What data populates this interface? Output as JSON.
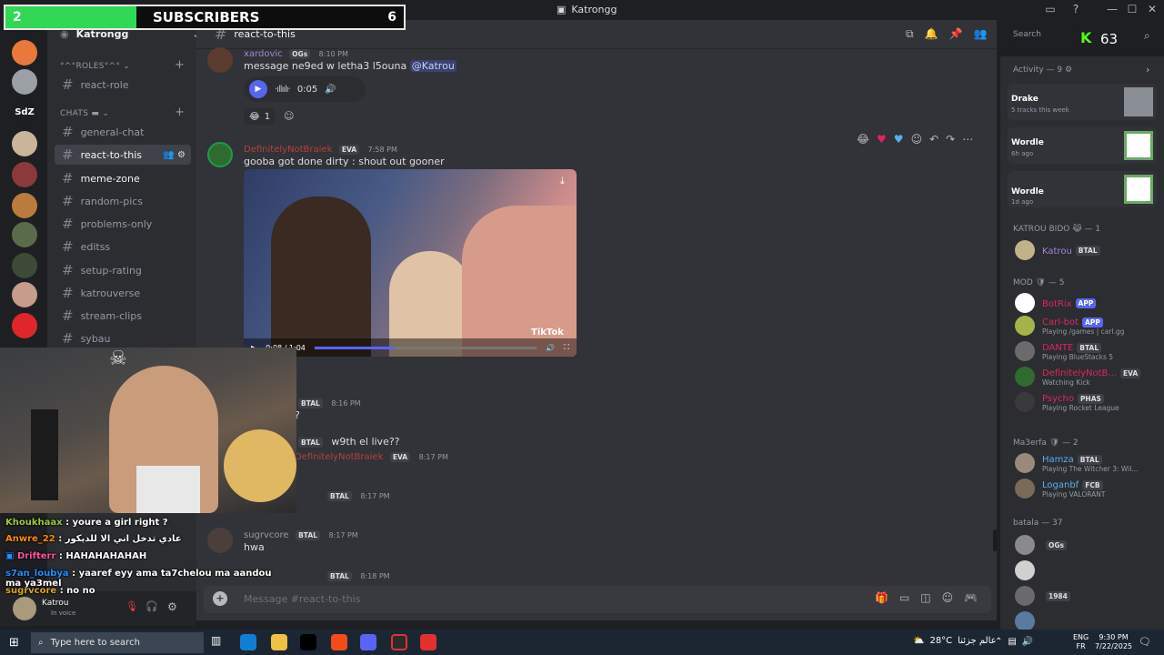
{
  "overlay": {
    "subscriber_count": "2",
    "subscriber_label": "SUBSCRIBERS",
    "subscriber_goal": "6"
  },
  "app": {
    "title": "Katrongg",
    "k_logo": "K",
    "k_count": "63"
  },
  "server": {
    "name": "Katrongg"
  },
  "categories": {
    "roles": "°^°ROLES°^°",
    "chats": "CHATS"
  },
  "channels": [
    {
      "name": "react-role"
    },
    {
      "name": "general-chat"
    },
    {
      "name": "react-to-this"
    },
    {
      "name": "meme-zone"
    },
    {
      "name": "random-pics"
    },
    {
      "name": "problems-only"
    },
    {
      "name": "editss"
    },
    {
      "name": "setup-rating"
    },
    {
      "name": "katrouverse"
    },
    {
      "name": "stream-clips"
    },
    {
      "name": "sybau"
    }
  ],
  "header": {
    "channel": "react-to-this",
    "search_placeholder": "Search"
  },
  "messages": {
    "m1": {
      "user": "xardovic",
      "tag": "OGs",
      "time": "8:10 PM",
      "text": "message ne9ed w letha3 l5ouna",
      "mention": "@Katrou",
      "audio_time": "0:05",
      "reaction_count": "1"
    },
    "m2": {
      "user": "DefinitelyNotBraiek",
      "tag": "EVA",
      "time": "7:58 PM",
      "text": "gooba got done dirty : shout out gooner",
      "video_time": "0:08 / 1:04",
      "watermark": "TikTok"
    },
    "m3": {
      "tag": "BTAL",
      "time": "8:16 PM",
      "text": "?"
    },
    "m4": {
      "tag": "BTAL",
      "text": "w9th el live??"
    },
    "m5": {
      "user": "DefinitelyNotBraiek",
      "tag": "EVA",
      "time": "8:17 PM"
    },
    "m6": {
      "tag": "BTAL",
      "time": "8:17 PM"
    },
    "m7": {
      "user": "sugrvcore",
      "tag": "BTAL",
      "time": "8:17 PM",
      "text": "hwa"
    },
    "m8": {
      "tag": "BTAL",
      "time": "8:18 PM"
    }
  },
  "composer": {
    "placeholder": "Message #react-to-this"
  },
  "activity": {
    "label": "Activity — 9",
    "items": [
      {
        "title": "Drake",
        "sub": "5 tracks this week"
      },
      {
        "title": "Wordle",
        "sub": "6h ago"
      },
      {
        "title": "Wordle",
        "sub": "1d ago"
      }
    ]
  },
  "members": {
    "s1": {
      "label": "KATROU BIDO 😹 — 1"
    },
    "s2": {
      "label": "MOD 🛡 — 5"
    },
    "s3": {
      "label": "Ma3erfa 🛡 — 2"
    },
    "s4": {
      "label": "batala — 37"
    },
    "list": [
      {
        "name": "Katrou",
        "tag": "BTAL",
        "status": ""
      },
      {
        "name": "BotRix",
        "tag": "APP",
        "status": ""
      },
      {
        "name": "Carl-bot",
        "tag": "APP",
        "status": "Playing /games | carl.gg"
      },
      {
        "name": "DANTE",
        "tag": "BTAL",
        "status": "Playing BlueStacks 5"
      },
      {
        "name": "DefinitelyNotB...",
        "tag": "EVA",
        "status": "Watching Kick"
      },
      {
        "name": "Psycho",
        "tag": "PHAS",
        "status": "Playing Rocket League"
      },
      {
        "name": "Hamza",
        "tag": "BTAL",
        "status": "Playing The Witcher 3: Wil..."
      },
      {
        "name": "Loganbf",
        "tag": "FCB",
        "status": "Playing VALORANT"
      },
      {
        "name": "",
        "tag": "OGs",
        "status": ""
      },
      {
        "name": "",
        "tag": "",
        "status": ""
      },
      {
        "name": "",
        "tag": "1984",
        "status": ""
      },
      {
        "name": "",
        "tag": "",
        "status": ""
      }
    ]
  },
  "stream_chat": [
    {
      "user": "Khoukhaax",
      "text": ": youre a girl right ?",
      "color": "#9acd32"
    },
    {
      "user": "Anwre_22",
      "text": ": عادي تدخل اني الا للديكور",
      "color": "#ff8c00"
    },
    {
      "user": "Drifterr",
      "text": ": HAHAHAHAHAH",
      "color": "#ff4fa3"
    },
    {
      "user": "s7an_loubya",
      "text": ": yaaref eyy ama ta7chelou ma aandou ma ya3mel",
      "color": "#1e90ff"
    },
    {
      "user": "sugrvcore",
      "text": ": no no",
      "color": "#daa520"
    }
  ],
  "user_panel": {
    "name": "Katrou",
    "status": "In voice"
  },
  "taskbar": {
    "search": "Type here to search",
    "weather": "28°C",
    "weather_city": "عالم جزئنا",
    "lang1": "ENG",
    "lang2": "FR",
    "time": "9:30 PM",
    "date": "7/22/2025"
  },
  "colors": {
    "accent": "#5865f2",
    "green_bar": "#30d856"
  }
}
